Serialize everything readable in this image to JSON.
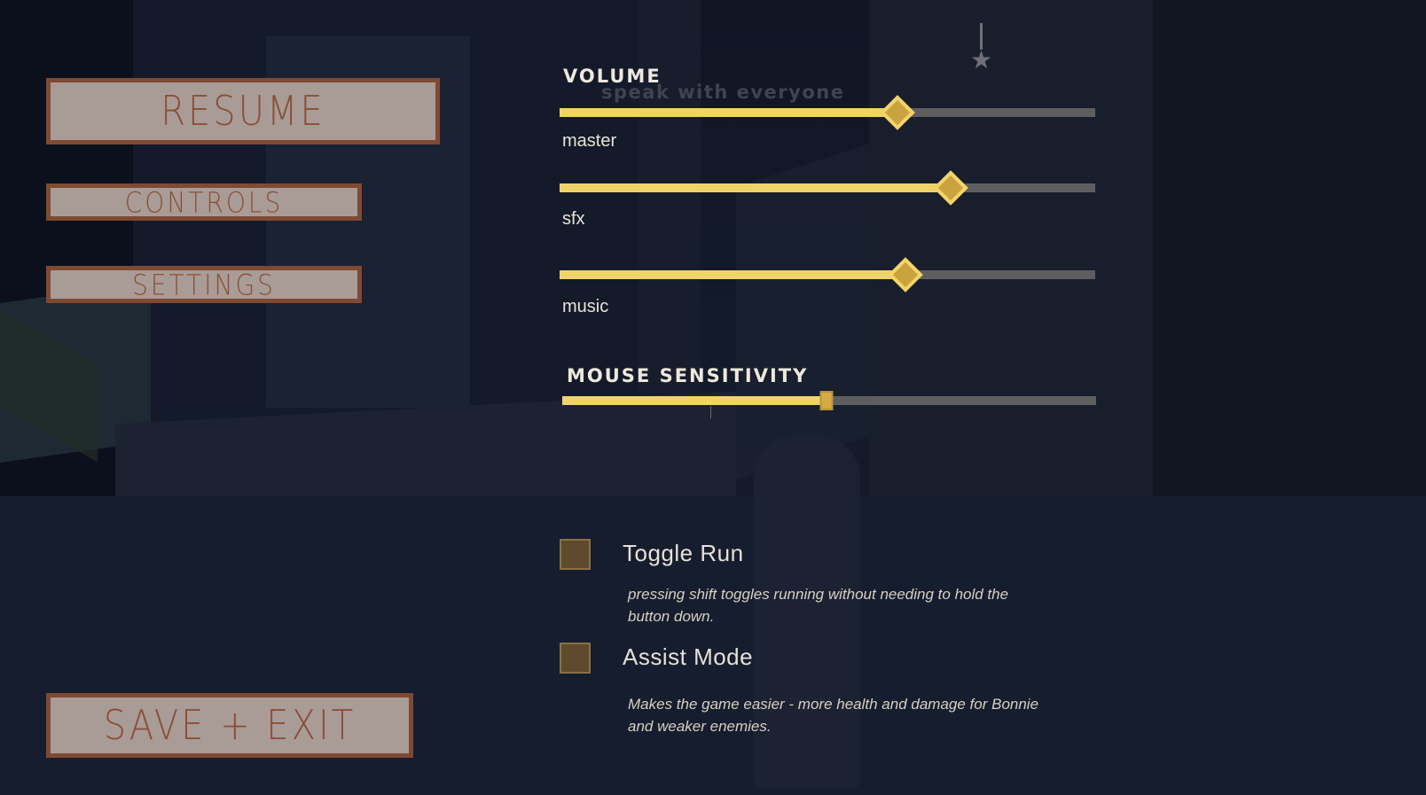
{
  "menu": {
    "resume_label": "RESUME",
    "controls_label": "CONTROLS",
    "settings_label": "SETTINGS",
    "save_exit_label": "SAVE + EXIT",
    "button_bg": "#a99c97",
    "button_border": "#7f4a32",
    "button_text": "#8b4f36"
  },
  "quest": {
    "text": "speak with everyone",
    "icon": "star-icon"
  },
  "volume": {
    "title": "VOLUME",
    "master": {
      "label": "master",
      "value": 0.63
    },
    "sfx": {
      "label": "sfx",
      "value": 0.73
    },
    "music": {
      "label": "music",
      "value": 0.645
    }
  },
  "mouse": {
    "title": "MOUSE SENSITIVITY",
    "value": 0.495
  },
  "options": {
    "toggle_run": {
      "label": "Toggle Run",
      "description": "pressing shift toggles running without needing to hold the button down.",
      "checked": false
    },
    "assist_mode": {
      "label": "Assist Mode",
      "description": "Makes the game easier - more health and damage for Bonnie and weaker enemies.",
      "checked": false
    }
  },
  "colors": {
    "slider_fill": "#f0d36a",
    "slider_track": "#5e5e60",
    "knob": "#c9a43e",
    "checkbox": "#5e4a2c"
  }
}
